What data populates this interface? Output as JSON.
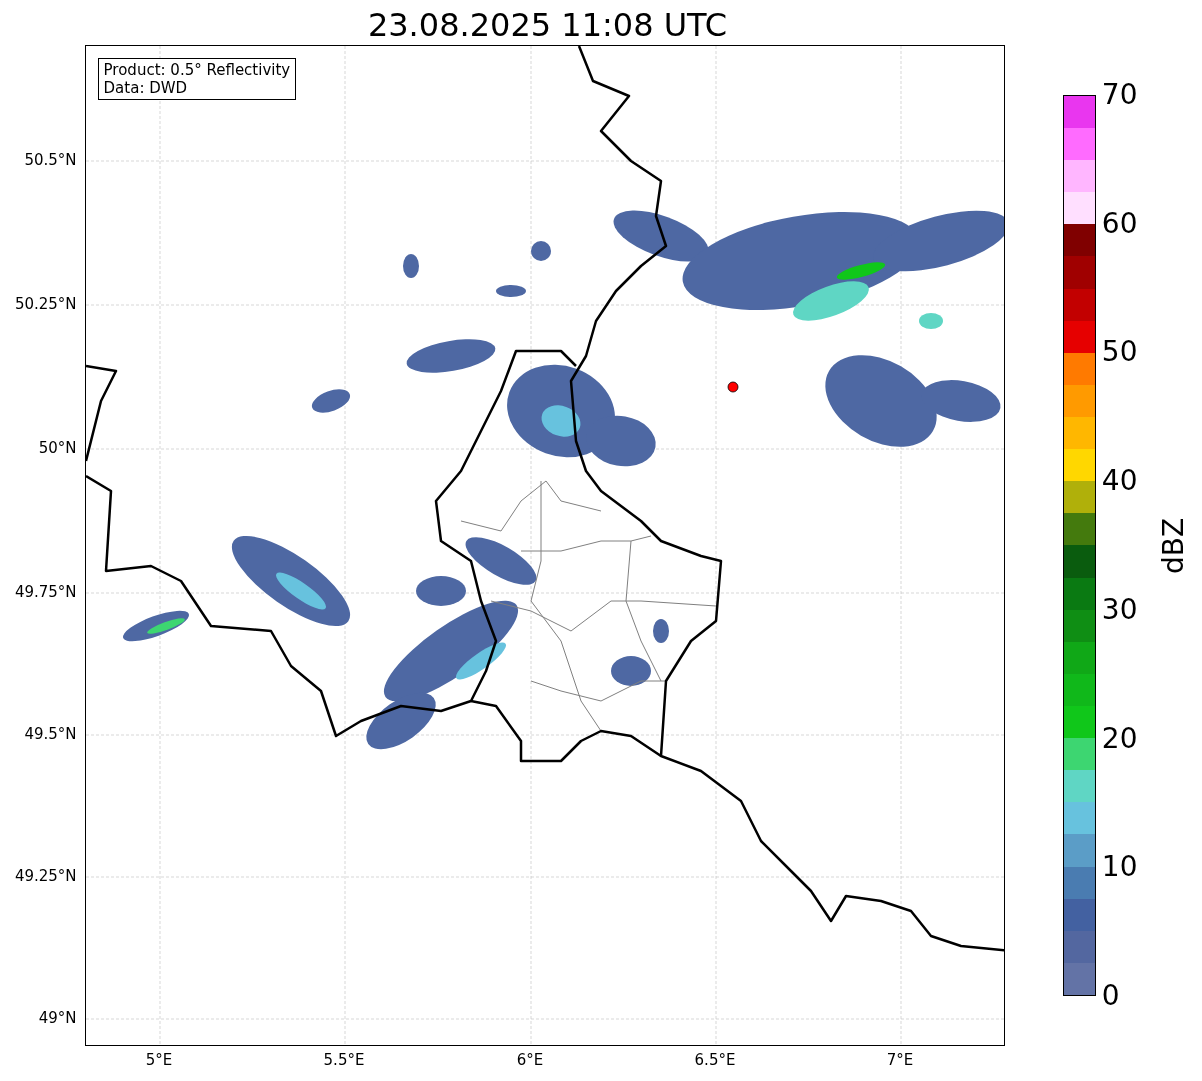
{
  "title": "23.08.2025 11:08 UTC",
  "info_box": [
    "Product: 0.5° Reflectivity",
    "Data: DWD"
  ],
  "lat_ticks": [
    "50.5°N",
    "50.25°N",
    "50°N",
    "49.75°N",
    "49.5°N",
    "49.25°N",
    "49°N"
  ],
  "lon_ticks": [
    "5°E",
    "5.5°E",
    "6°E",
    "6.5°E",
    "7°E"
  ],
  "colorbar": {
    "label": "dBZ",
    "ticks": [
      "70",
      "60",
      "50",
      "40",
      "30",
      "20",
      "10",
      "0"
    ],
    "bins": [
      {
        "color": "#6373a6"
      },
      {
        "color": "#5367a0"
      },
      {
        "color": "#4361a1"
      },
      {
        "color": "#4a7cb1"
      },
      {
        "color": "#5b9dc7"
      },
      {
        "color": "#67c2de"
      },
      {
        "color": "#5fd6c4"
      },
      {
        "color": "#3dd671"
      },
      {
        "color": "#10c71a"
      },
      {
        "color": "#10b81a"
      },
      {
        "color": "#10a817"
      },
      {
        "color": "#0f8e14"
      },
      {
        "color": "#0a7a12"
      },
      {
        "color": "#0a5c0e"
      },
      {
        "color": "#447a0d"
      },
      {
        "color": "#b0b00a"
      },
      {
        "color": "#ffd700"
      },
      {
        "color": "#ffb700"
      },
      {
        "color": "#ff9a00"
      },
      {
        "color": "#ff7a00"
      },
      {
        "color": "#e60000"
      },
      {
        "color": "#c20000"
      },
      {
        "color": "#a00000"
      },
      {
        "color": "#800000"
      },
      {
        "color": "#ffdfff"
      },
      {
        "color": "#ffb6ff"
      },
      {
        "color": "#ff6bff"
      },
      {
        "color": "#e936ef"
      }
    ]
  }
}
